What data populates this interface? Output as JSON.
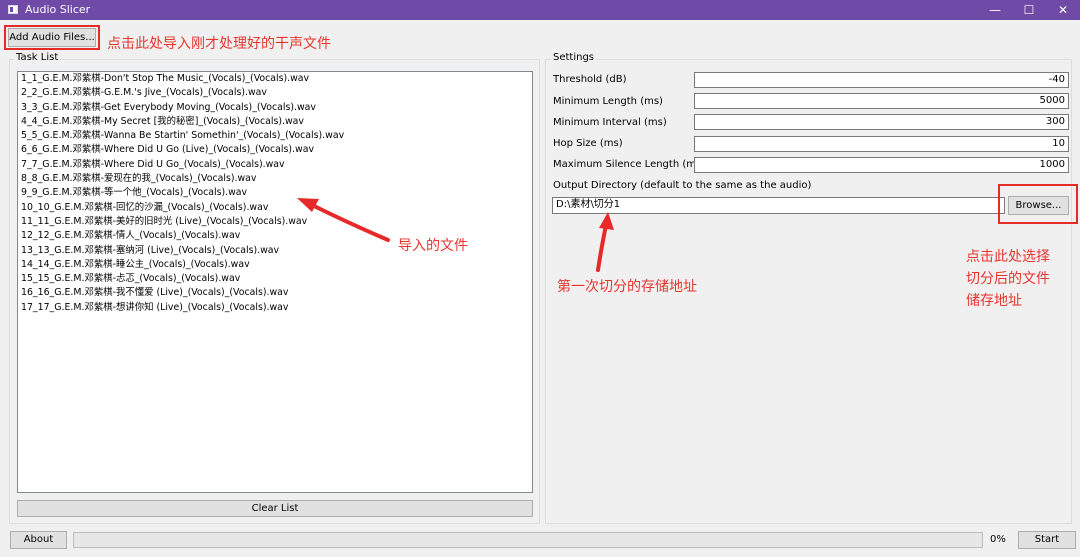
{
  "window": {
    "title": "Audio Slicer",
    "controls": [
      "—",
      "☐",
      "✕"
    ]
  },
  "toolbar": {
    "add_files_label": "Add Audio Files..."
  },
  "task_list": {
    "title": "Task List",
    "items": [
      "1_1_G.E.M.邓紫棋-Don't Stop The Music_(Vocals)_(Vocals).wav",
      "2_2_G.E.M.邓紫棋-G.E.M.'s Jive_(Vocals)_(Vocals).wav",
      "3_3_G.E.M.邓紫棋-Get Everybody Moving_(Vocals)_(Vocals).wav",
      "4_4_G.E.M.邓紫棋-My Secret [我的秘密]_(Vocals)_(Vocals).wav",
      "5_5_G.E.M.邓紫棋-Wanna Be Startin' Somethin'_(Vocals)_(Vocals).wav",
      "6_6_G.E.M.邓紫棋-Where Did U Go (Live)_(Vocals)_(Vocals).wav",
      "7_7_G.E.M.邓紫棋-Where Did U Go_(Vocals)_(Vocals).wav",
      "8_8_G.E.M.邓紫棋-爱现在的我_(Vocals)_(Vocals).wav",
      "9_9_G.E.M.邓紫棋-等一个他_(Vocals)_(Vocals).wav",
      "10_10_G.E.M.邓紫棋-回忆的沙漏_(Vocals)_(Vocals).wav",
      "11_11_G.E.M.邓紫棋-美好的旧时光 (Live)_(Vocals)_(Vocals).wav",
      "12_12_G.E.M.邓紫棋-情人_(Vocals)_(Vocals).wav",
      "13_13_G.E.M.邓紫棋-塞纳河 (Live)_(Vocals)_(Vocals).wav",
      "14_14_G.E.M.邓紫棋-睡公主_(Vocals)_(Vocals).wav",
      "15_15_G.E.M.邓紫棋-忐忑_(Vocals)_(Vocals).wav",
      "16_16_G.E.M.邓紫棋-我不懂爱 (Live)_(Vocals)_(Vocals).wav",
      "17_17_G.E.M.邓紫棋-想讲你知 (Live)_(Vocals)_(Vocals).wav"
    ],
    "clear_label": "Clear List"
  },
  "settings": {
    "title": "Settings",
    "fields": [
      {
        "label": "Threshold (dB)",
        "value": "-40"
      },
      {
        "label": "Minimum Length (ms)",
        "value": "5000"
      },
      {
        "label": "Minimum Interval (ms)",
        "value": "300"
      },
      {
        "label": "Hop Size (ms)",
        "value": "10"
      },
      {
        "label": "Maximum Silence Length (ms)",
        "value": "1000"
      }
    ],
    "output_label": "Output Directory (default to the same as the audio)",
    "output_value": "D:\\素材\\切分1",
    "browse_label": "Browse..."
  },
  "footer": {
    "about_label": "About",
    "progress_text": "0%",
    "progress_value": 0,
    "start_label": "Start"
  },
  "annotations": {
    "color": "#e8352f",
    "add_files_hint": "点击此处导入刚才处理好的干声文件",
    "imported_files_hint": "导入的文件",
    "output_path_hint": "第一次切分的存储地址",
    "browse_hint_lines": [
      "点击此处选择",
      "切分后的文件",
      "储存地址"
    ]
  }
}
